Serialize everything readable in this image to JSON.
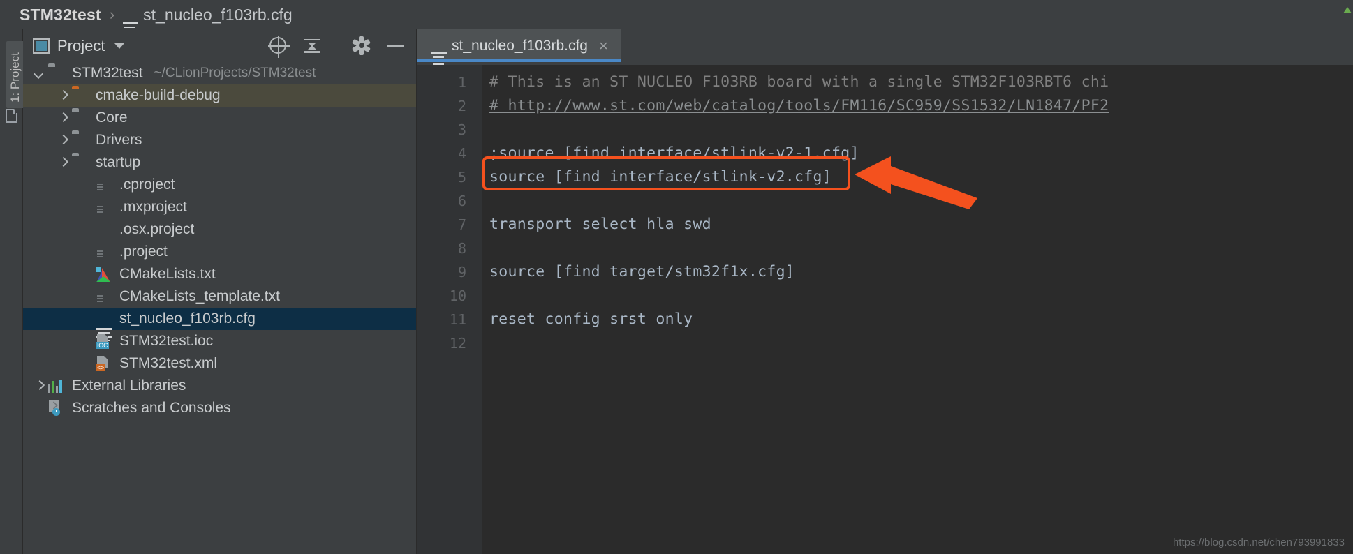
{
  "breadcrumb": {
    "project": "STM32test",
    "separator": "›",
    "file": "st_nucleo_f103rb.cfg"
  },
  "toolstrip": {
    "vertical_tab": "1: Project"
  },
  "project_panel": {
    "title": "Project",
    "actions": [
      {
        "name": "select-opened-file",
        "icon": "target-icon"
      },
      {
        "name": "collapse-all",
        "icon": "collapse-all-icon"
      },
      {
        "name": "settings",
        "icon": "gear-icon"
      },
      {
        "name": "hide",
        "icon": "minus-icon"
      }
    ],
    "tree": [
      {
        "label": "STM32test",
        "path": "~/CLionProjects/STM32test",
        "icon": "folder-icon",
        "arrow": "down",
        "indent": 0,
        "state": "normal"
      },
      {
        "label": "cmake-build-debug",
        "path": "",
        "icon": "folder-orange-icon",
        "arrow": "right",
        "indent": 1,
        "state": "selected-inactive"
      },
      {
        "label": "Core",
        "path": "",
        "icon": "folder-icon",
        "arrow": "right",
        "indent": 1,
        "state": "normal"
      },
      {
        "label": "Drivers",
        "path": "",
        "icon": "folder-icon",
        "arrow": "right",
        "indent": 1,
        "state": "normal"
      },
      {
        "label": "startup",
        "path": "",
        "icon": "folder-icon",
        "arrow": "right",
        "indent": 1,
        "state": "normal"
      },
      {
        "label": ".cproject",
        "path": "",
        "icon": "file-icon",
        "arrow": "none",
        "indent": 2,
        "state": "normal"
      },
      {
        "label": ".mxproject",
        "path": "",
        "icon": "file-icon",
        "arrow": "none",
        "indent": 2,
        "state": "normal"
      },
      {
        "label": ".osx.project",
        "path": "",
        "icon": "file-white-icon",
        "arrow": "none",
        "indent": 2,
        "state": "normal"
      },
      {
        "label": ".project",
        "path": "",
        "icon": "file-icon",
        "arrow": "none",
        "indent": 2,
        "state": "normal"
      },
      {
        "label": "CMakeLists.txt",
        "path": "",
        "icon": "cmake-icon",
        "arrow": "none",
        "indent": 2,
        "state": "normal"
      },
      {
        "label": "CMakeLists_template.txt",
        "path": "",
        "icon": "file-icon",
        "arrow": "none",
        "indent": 2,
        "state": "normal"
      },
      {
        "label": "st_nucleo_f103rb.cfg",
        "path": "",
        "icon": "cfg-icon",
        "arrow": "none",
        "indent": 2,
        "state": "selected-active"
      },
      {
        "label": "STM32test.ioc",
        "path": "",
        "icon": "ioc-icon",
        "arrow": "none",
        "indent": 2,
        "state": "normal"
      },
      {
        "label": "STM32test.xml",
        "path": "",
        "icon": "xml-icon",
        "arrow": "none",
        "indent": 2,
        "state": "normal"
      },
      {
        "label": "External Libraries",
        "path": "",
        "icon": "libraries-icon",
        "arrow": "right",
        "indent": 0,
        "state": "normal"
      },
      {
        "label": "Scratches and Consoles",
        "path": "",
        "icon": "scratches-icon",
        "arrow": "none",
        "indent": 0,
        "state": "normal"
      }
    ]
  },
  "editor": {
    "tab": {
      "label": "st_nucleo_f103rb.cfg",
      "close": "×",
      "icon": "cfg-icon"
    },
    "line_numbers": [
      "1",
      "2",
      "3",
      "4",
      "5",
      "6",
      "7",
      "8",
      "9",
      "10",
      "11",
      "12"
    ],
    "lines": [
      {
        "n": "1",
        "text": "# This is an ST NUCLEO F103RB board with a single STM32F103RBT6 chi",
        "kind": "comment"
      },
      {
        "n": "2",
        "text": "# http://www.st.com/web/catalog/tools/FM116/SC959/SS1532/LN1847/PF2",
        "kind": "comment-link"
      },
      {
        "n": "3",
        "text": "",
        "kind": "blank"
      },
      {
        "n": "4",
        "text": ";source [find interface/stlink-v2-1.cfg]",
        "kind": "code"
      },
      {
        "n": "5",
        "text": "source [find interface/stlink-v2.cfg]",
        "kind": "code"
      },
      {
        "n": "6",
        "text": "",
        "kind": "blank"
      },
      {
        "n": "7",
        "text": "transport select hla_swd",
        "kind": "code"
      },
      {
        "n": "8",
        "text": "",
        "kind": "blank"
      },
      {
        "n": "9",
        "text": "source [find target/stm32f1x.cfg]",
        "kind": "code"
      },
      {
        "n": "10",
        "text": "",
        "kind": "blank"
      },
      {
        "n": "11",
        "text": "reset_config srst_only",
        "kind": "code"
      },
      {
        "n": "12",
        "text": "",
        "kind": "blank"
      }
    ]
  },
  "annotations": {
    "highlight_color": "#f4511e",
    "highlight_target_line": "5",
    "arrow_color": "#f4511e"
  },
  "watermark": "https://blog.csdn.net/chen793991833"
}
